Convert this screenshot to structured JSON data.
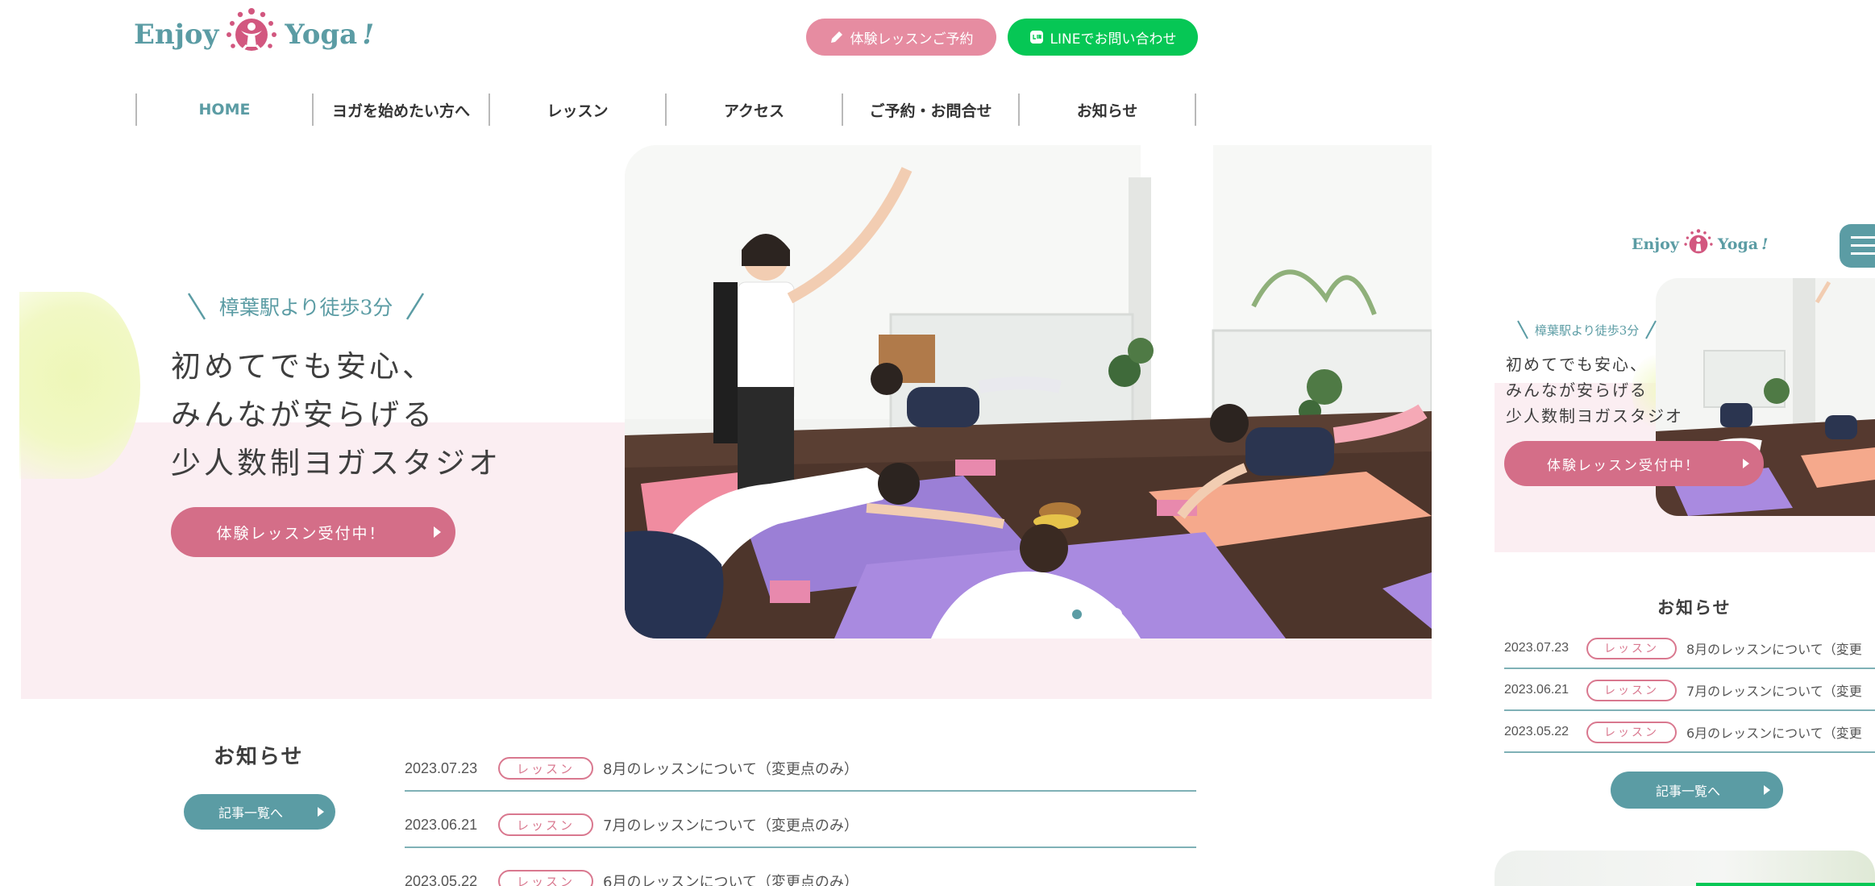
{
  "brand": {
    "name_left": "Enjoy",
    "name_right": "Yoga",
    "exclaim": "!"
  },
  "header": {
    "trial_button": "体験レッスンご予約",
    "line_button": "LINEでお問い合わせ"
  },
  "nav": [
    {
      "label": "HOME",
      "active": true
    },
    {
      "label": "ヨガを始めたい方へ"
    },
    {
      "label": "レッスン"
    },
    {
      "label": "アクセス"
    },
    {
      "label": "ご予約・お問合せ"
    },
    {
      "label": "お知らせ"
    }
  ],
  "hero": {
    "subtitle": "樟葉駅より徒歩3分",
    "line1": "初めてでも安心、",
    "line2": "みんなが安らげる",
    "line3": "少人数制ヨガスタジオ",
    "cta": "体験レッスン受付中！",
    "slides_total": 3,
    "slide_active": 1
  },
  "news": {
    "heading": "お知らせ",
    "more_button": "記事一覧へ",
    "items": [
      {
        "date": "2023.07.23",
        "tag": "レッスン",
        "title": "8月のレッスンについて（変更点のみ）"
      },
      {
        "date": "2023.06.21",
        "tag": "レッスン",
        "title": "7月のレッスンについて（変更点のみ）"
      },
      {
        "date": "2023.05.22",
        "tag": "レッスン",
        "title": "6月のレッスンについて（変更点のみ）"
      }
    ]
  },
  "mobile": {
    "news_items": [
      {
        "date": "2023.07.23",
        "tag": "レッスン",
        "title": "8月のレッスンについて（変更"
      },
      {
        "date": "2023.06.21",
        "tag": "レッスン",
        "title": "7月のレッスンについて（変更"
      },
      {
        "date": "2023.05.22",
        "tag": "レッスン",
        "title": "6月のレッスンについて（変更"
      }
    ]
  },
  "colors": {
    "teal": "#5b9ca4",
    "pink": "#d9788f",
    "line_green": "#06c755",
    "pink_bg": "#fbeef2"
  }
}
